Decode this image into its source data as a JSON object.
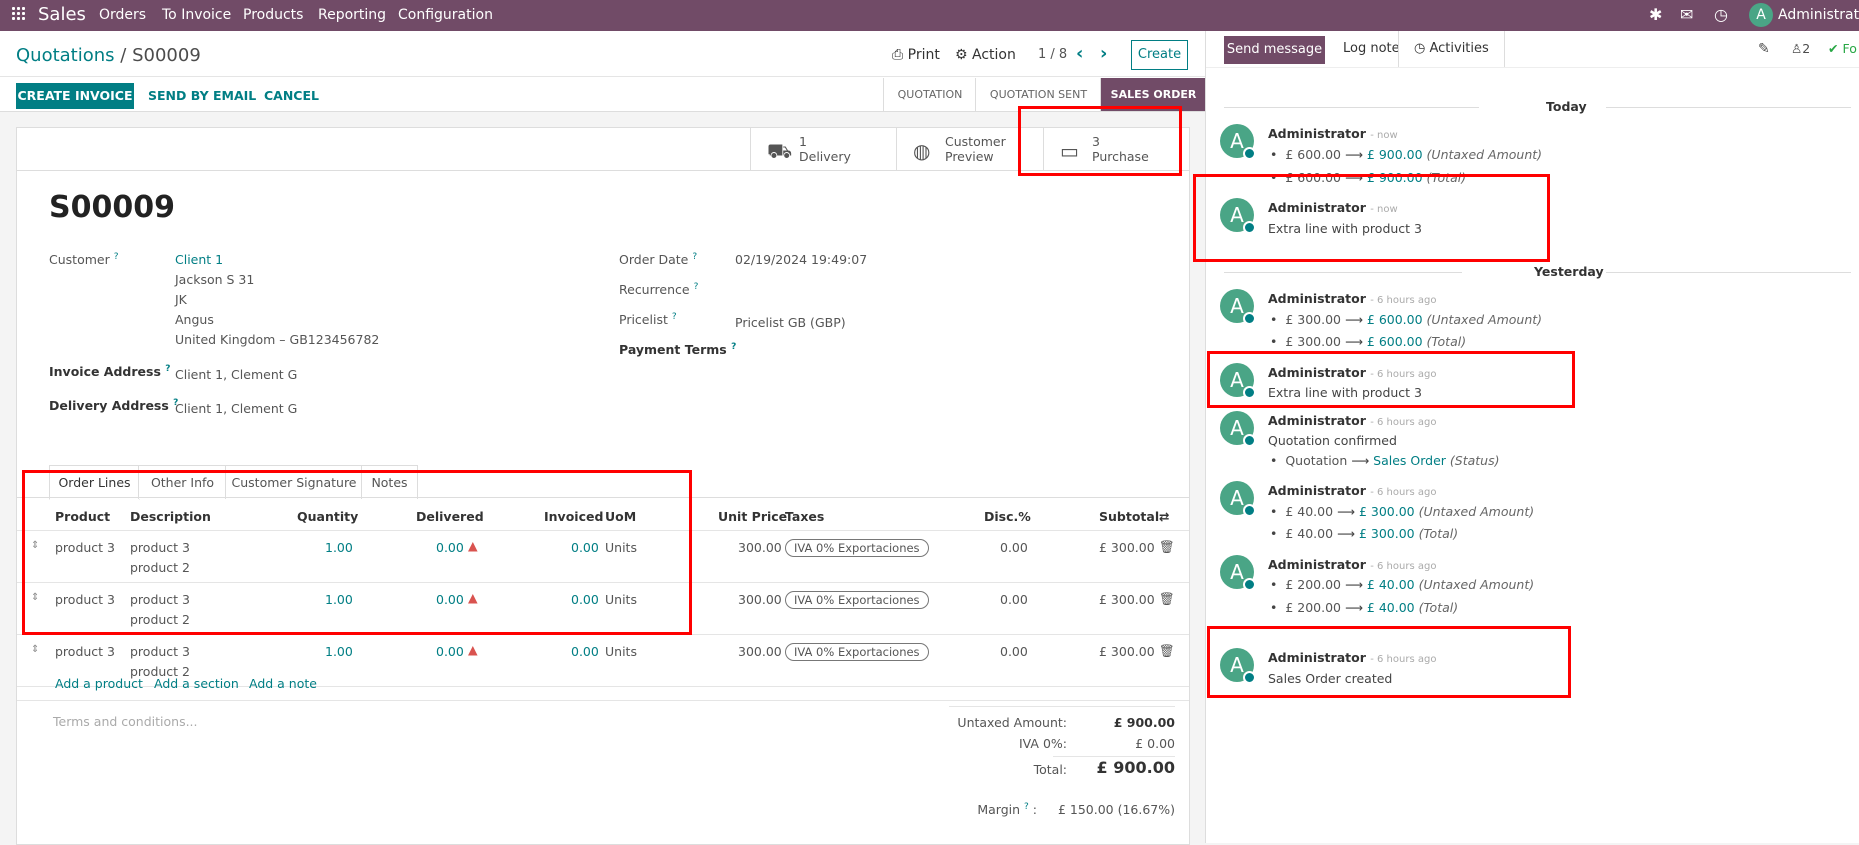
{
  "topbar": {
    "app": "Sales",
    "menu": [
      "Orders",
      "To Invoice",
      "Products",
      "Reporting",
      "Configuration"
    ],
    "avatar_letter": "A",
    "user": "Administrator"
  },
  "breadcrumb": {
    "parent": "Quotations",
    "sep": "/",
    "current": "S00009"
  },
  "actions": {
    "print": "Print",
    "action": "Action",
    "pager": "1 / 8",
    "create": "Create"
  },
  "buttons": {
    "create_invoice": "CREATE INVOICE",
    "send_email": "SEND BY EMAIL",
    "cancel": "CANCEL"
  },
  "stages": [
    {
      "label": "QUOTATION",
      "active": false
    },
    {
      "label": "QUOTATION SENT",
      "active": false
    },
    {
      "label": "SALES ORDER",
      "active": true
    }
  ],
  "smart_buttons": [
    {
      "line1": "1",
      "line2": "Delivery",
      "icon": "truck-icon"
    },
    {
      "line1": "Customer",
      "line2": "Preview",
      "icon": "globe-icon"
    },
    {
      "line1": "3",
      "line2": "Purchase",
      "icon": "credit-card-icon"
    }
  ],
  "order": {
    "name": "S00009",
    "customer_label": "Customer",
    "customer_name": "Client 1",
    "customer_address": [
      "Jackson S 31",
      "JK",
      "Angus",
      "United Kingdom – GB123456782"
    ],
    "invoice_address_label": "Invoice Address",
    "invoice_address": "Client 1, Clement G",
    "delivery_address_label": "Delivery Address",
    "delivery_address": "Client 1, Clement G",
    "order_date_label": "Order Date",
    "order_date": "02/19/2024 19:49:07",
    "recurrence_label": "Recurrence",
    "pricelist_label": "Pricelist",
    "pricelist": "Pricelist GB (GBP)",
    "payment_terms_label": "Payment Terms"
  },
  "tabs": [
    "Order Lines",
    "Other Info",
    "Customer Signature",
    "Notes"
  ],
  "table": {
    "headers": [
      "Product",
      "Description",
      "Quantity",
      "Delivered",
      "Invoiced",
      "UoM",
      "Unit Price",
      "Taxes",
      "Disc.%",
      "Subtotal"
    ],
    "rows": [
      {
        "product": "product 3",
        "desc1": "product 3",
        "desc2": "product 2",
        "qty": "1.00",
        "delivered": "0.00",
        "invoiced": "0.00",
        "uom": "Units",
        "price": "300.00",
        "tax": "IVA 0% Exportaciones",
        "disc": "0.00",
        "subtotal": "£ 300.00"
      },
      {
        "product": "product 3",
        "desc1": "product 3",
        "desc2": "product 2",
        "qty": "1.00",
        "delivered": "0.00",
        "invoiced": "0.00",
        "uom": "Units",
        "price": "300.00",
        "tax": "IVA 0% Exportaciones",
        "disc": "0.00",
        "subtotal": "£ 300.00"
      },
      {
        "product": "product 3",
        "desc1": "product 3",
        "desc2": "product 2",
        "qty": "1.00",
        "delivered": "0.00",
        "invoiced": "0.00",
        "uom": "Units",
        "price": "300.00",
        "tax": "IVA 0% Exportaciones",
        "disc": "0.00",
        "subtotal": "£ 300.00"
      }
    ],
    "add_product": "Add a product",
    "add_section": "Add a section",
    "add_note": "Add a note"
  },
  "terms_placeholder": "Terms and conditions...",
  "totals": {
    "untaxed_label": "Untaxed Amount:",
    "untaxed": "£ 900.00",
    "tax_label": "IVA 0%:",
    "tax": "£ 0.00",
    "total_label": "Total:",
    "total": "£ 900.00",
    "margin_label": "Margin",
    "margin": "£ 150.00 (16.67%)"
  },
  "chatter": {
    "send_message": "Send message",
    "log_note": "Log note",
    "activities": "Activities",
    "followers_count": "2",
    "follow": "Fo",
    "today": "Today",
    "yesterday": "Yesterday",
    "messages": [
      {
        "author": "Administrator",
        "when": "- now",
        "lines": [
          {
            "old": "£ 600.00",
            "arrow": "⟶",
            "new": "£ 900.00",
            "field": "(Untaxed Amount)"
          },
          {
            "old": "£ 600.00",
            "arrow": "⟶",
            "new": "£ 900.00",
            "field": "(Total)"
          }
        ]
      },
      {
        "author": "Administrator",
        "when": "- now",
        "text": "Extra line with product 3"
      },
      {
        "author": "Administrator",
        "when": "- 6 hours ago",
        "lines": [
          {
            "old": "£ 300.00",
            "arrow": "⟶",
            "new": "£ 600.00",
            "field": "(Untaxed Amount)"
          },
          {
            "old": "£ 300.00",
            "arrow": "⟶",
            "new": "£ 600.00",
            "field": "(Total)"
          }
        ]
      },
      {
        "author": "Administrator",
        "when": "- 6 hours ago",
        "text": "Extra line with product 3"
      },
      {
        "author": "Administrator",
        "when": "- 6 hours ago",
        "text": "Quotation confirmed",
        "lines": [
          {
            "old": "Quotation",
            "arrow": "⟶",
            "new": "Sales Order",
            "field": "(Status)"
          }
        ]
      },
      {
        "author": "Administrator",
        "when": "- 6 hours ago",
        "lines": [
          {
            "old": "£ 40.00",
            "arrow": "⟶",
            "new": "£ 300.00",
            "field": "(Untaxed Amount)"
          },
          {
            "old": "£ 40.00",
            "arrow": "⟶",
            "new": "£ 300.00",
            "field": "(Total)"
          }
        ]
      },
      {
        "author": "Administrator",
        "when": "- 6 hours ago",
        "lines": [
          {
            "old": "£ 200.00",
            "arrow": "⟶",
            "new": "£ 40.00",
            "field": "(Untaxed Amount)"
          },
          {
            "old": "£ 200.00",
            "arrow": "⟶",
            "new": "£ 40.00",
            "field": "(Total)"
          }
        ]
      },
      {
        "author": "Administrator",
        "when": "- 6 hours ago",
        "text": "Sales Order created"
      }
    ]
  },
  "colors": {
    "brand": "#714b67",
    "accent": "#017e84",
    "highlight": "#ff0000"
  }
}
